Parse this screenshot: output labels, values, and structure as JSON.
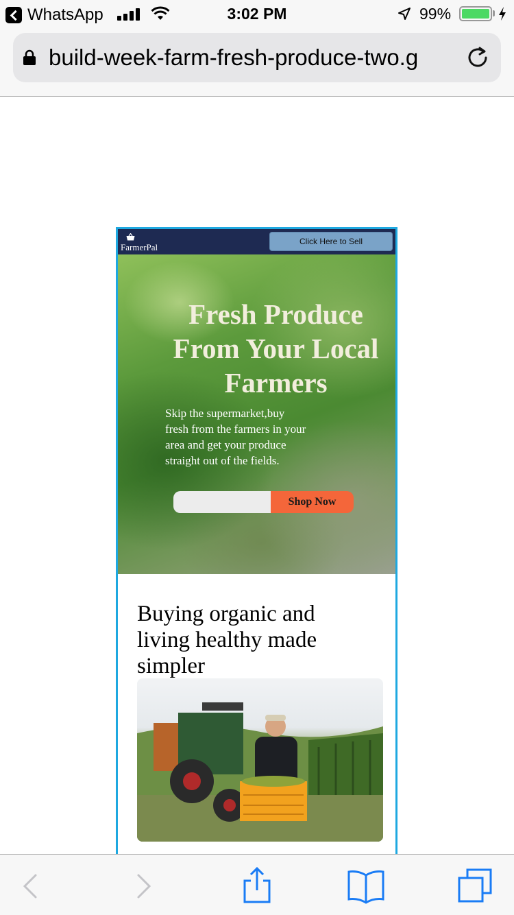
{
  "status_bar": {
    "back_app": "WhatsApp",
    "time": "3:02 PM",
    "battery_percent": "99%",
    "battery_level": 0.99,
    "icons": [
      "back-arrow-icon",
      "signal-icon",
      "wifi-icon",
      "location-arrow-icon",
      "battery-icon",
      "charging-bolt-icon"
    ]
  },
  "browser": {
    "url": "build-week-farm-fresh-produce-two.g",
    "icons": [
      "lock-icon",
      "reload-icon"
    ]
  },
  "site": {
    "brand": "FarmerPal",
    "sell_button": "Click Here to Sell",
    "hero": {
      "title": "Fresh Produce From Your Local Farmers",
      "subtitle": "Skip the supermarket,buy fresh from the farmers in your area and get your produce straight out of the fields.",
      "input_value": "",
      "shop_button": "Shop Now"
    },
    "section": {
      "heading": "Buying organic and living healthy made simpler"
    }
  },
  "toolbar": {
    "icons": [
      "back-icon",
      "forward-icon",
      "share-icon",
      "bookmarks-icon",
      "tabs-icon"
    ]
  },
  "colors": {
    "nav_bg": "#1e2a52",
    "sell_button": "#7aa3c8",
    "shop_button": "#f4663a",
    "frame_border": "#1ea8e0",
    "ios_tint": "#1a7cf5",
    "battery": "#4cd964"
  }
}
